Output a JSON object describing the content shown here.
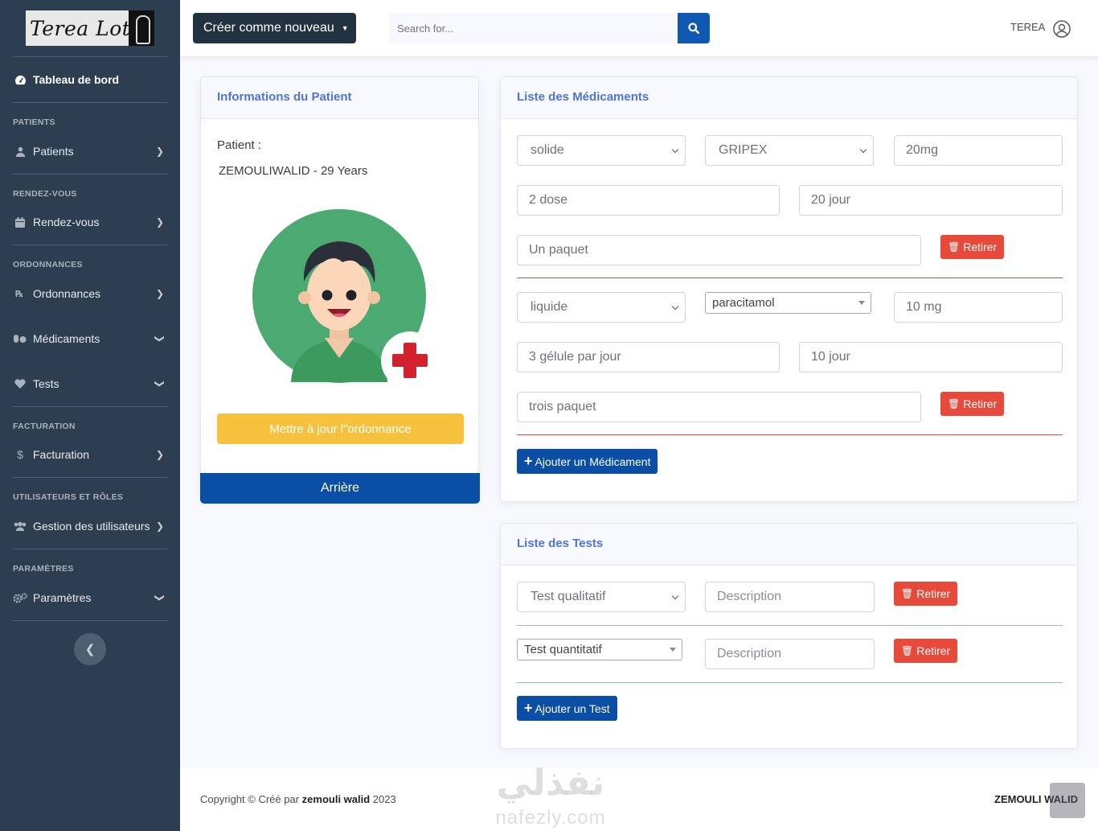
{
  "sidebar": {
    "brand": "Terea Lotfi",
    "dashboard": "Tableau de bord",
    "sections": {
      "patients": "PATIENTS",
      "rdv": "RENDEZ-VOUS",
      "ordonnances": "ORDONNANCES",
      "facturation": "FACTURATION",
      "users": "UTILISATEURS ET RÔLES",
      "params": "PARAMÈTRES"
    },
    "items": {
      "patients": "Patients",
      "rdv": "Rendez-vous",
      "ordonnances": "Ordonnances",
      "medicaments": "Médicaments",
      "tests": "Tests",
      "facturation": "Facturation",
      "users": "Gestion des utilisateurs",
      "params": "Paramètres"
    }
  },
  "topbar": {
    "create_label": "Créer comme nouveau",
    "search_placeholder": "Search for...",
    "user_name": "TEREA"
  },
  "patient_card": {
    "title": "Informations du Patient",
    "label": "Patient :",
    "value": "ZEMOULIWALID - 29 Years",
    "update_label": "Mettre à jour l\"ordonnance",
    "back_label": "Arrière"
  },
  "med_card": {
    "title": "Liste des Médicaments",
    "remove_label": "Retirer",
    "add_label": "Ajouter un Médicament",
    "rows": [
      {
        "type": "solide",
        "name": "GRIPEX",
        "dosage": "20mg",
        "dose": "2 dose",
        "duration": "20 jour",
        "quantity": "Un paquet"
      },
      {
        "type": "liquide",
        "name": "paracitamol",
        "dosage": "10 mg",
        "dose": "3 gélule par jour",
        "duration": "10 jour",
        "quantity": "trois paquet"
      }
    ]
  },
  "tests_card": {
    "title": "Liste des Tests",
    "remove_label": "Retirer",
    "add_label": "Ajouter un Test",
    "rows": [
      {
        "type": "Test qualitatif",
        "description_placeholder": "Description"
      },
      {
        "type": "Test quantitatif",
        "description_placeholder": "Description"
      }
    ]
  },
  "footer": {
    "copyright_prefix": "Copyright © Créé par",
    "author": "zemouli walid",
    "year": "2023",
    "user": "ZEMOULI WALID"
  },
  "watermark": {
    "arabic": "نفذلي",
    "latin": "nafezly.com"
  },
  "colors": {
    "sidebar_bg": "#2d3e50",
    "primary": "#0b4ea6",
    "danger": "#e74a3b",
    "warning": "#f6c23e",
    "header_text": "#4e73df"
  }
}
